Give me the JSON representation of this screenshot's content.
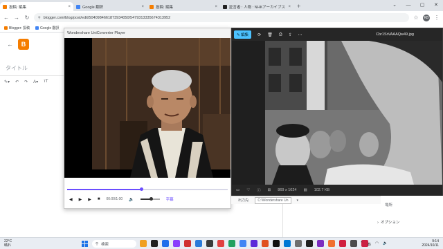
{
  "browser": {
    "tabs": [
      {
        "title": "投稿: 編集",
        "active": true,
        "favicon_color": "#f57d00"
      },
      {
        "title": "Google 翻訳",
        "active": false,
        "favicon_color": "#4285f4"
      },
      {
        "title": "投稿: 編集",
        "active": false,
        "favicon_color": "#f57d00"
      },
      {
        "title": "証言者 : 人物 : NHKアーカイブス",
        "active": false,
        "favicon_color": "#1f1f1f"
      }
    ],
    "new_tab": "+",
    "url": "blogger.com/blog/post/edit/5040984661873934050/5479313335674313952",
    "bookmarks": [
      {
        "label": "Blogger: 投稿",
        "favicon_color": "#f57d00"
      },
      {
        "label": "Google 翻訳",
        "favicon_color": "#4285f4"
      }
    ],
    "profile_initials": "KB"
  },
  "blogger": {
    "title_placeholder": "タイトル",
    "sidebar_label_1": "場所",
    "sidebar_label_2": "オプション"
  },
  "player": {
    "window_title": "Wondershare UniConverter Player",
    "time": "00:00/1:00",
    "progress": 0.46,
    "volume": 0.55,
    "subtitle_label": "字幕"
  },
  "photos": {
    "edit_label": "編集",
    "filename": "Cbr1SrVAAAQw49.jpg",
    "dimensions": "869 x 1024",
    "filesize": "102.7 KB"
  },
  "installer": {
    "label": "出力先:",
    "path": "C:\\Wondershare Un"
  },
  "taskbar": {
    "weather_temp": "22°C",
    "weather_cond": "晴れ",
    "search_placeholder": "検索",
    "time": "9:14",
    "date": "2024/10/11",
    "app_icon_colors": [
      "#f0a020",
      "#202020",
      "#1f6feb",
      "#8a3ffc",
      "#d03030",
      "#2b7bd9",
      "#3a3a3a",
      "#e04040",
      "#20a060",
      "#4285f4",
      "#5b2bd9",
      "#e05020",
      "#101010",
      "#0078d4",
      "#6e6e6e",
      "#202020",
      "#7b2cbf",
      "#f07030",
      "#d02040",
      "#4c4c4c",
      "#cc2244"
    ]
  }
}
